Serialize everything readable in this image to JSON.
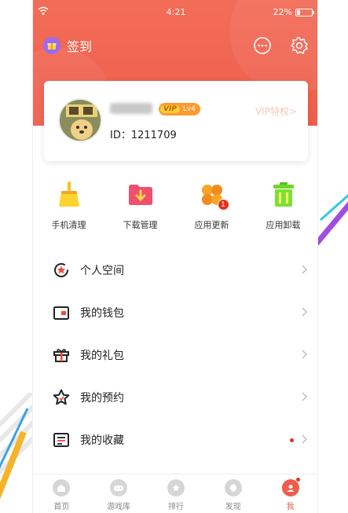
{
  "colors": {
    "accent": "#ef5d4b",
    "badge": "#e8321c",
    "vip_orange": "#ff9a2e"
  },
  "status_bar": {
    "time": "4:21",
    "battery": "22%",
    "battery_level": 0.22
  },
  "header": {
    "signin_label": "签到",
    "signin_icon": "gift-icon",
    "message_icon": "chat-bubble-icon",
    "settings_icon": "gear-icon"
  },
  "profile": {
    "vip_text": "VIP",
    "level": "Lv4",
    "uid": "ID：1211709",
    "vip_link": "VIP特权>"
  },
  "tools": [
    {
      "label": "手机清理",
      "icon": "broom-icon"
    },
    {
      "label": "下载管理",
      "icon": "download-folder-icon"
    },
    {
      "label": "应用更新",
      "icon": "clover-icon",
      "badge": "1"
    },
    {
      "label": "应用卸载",
      "icon": "trash-icon"
    }
  ],
  "menu": [
    {
      "label": "个人空间",
      "icon": "star-badge-icon"
    },
    {
      "label": "我的钱包",
      "icon": "wallet-icon"
    },
    {
      "label": "我的礼包",
      "icon": "gift-box-icon"
    },
    {
      "label": "我的预约",
      "icon": "star-outline-icon"
    },
    {
      "label": "我的收藏",
      "icon": "list-box-icon",
      "has_dot": true
    }
  ],
  "tabbar": [
    {
      "label": "首页",
      "icon": "home-icon"
    },
    {
      "label": "游戏库",
      "icon": "gamepad-icon"
    },
    {
      "label": "排行",
      "icon": "trophy-icon"
    },
    {
      "label": "发现",
      "icon": "compass-icon"
    },
    {
      "label": "我",
      "icon": "profile-icon",
      "active": true
    }
  ]
}
